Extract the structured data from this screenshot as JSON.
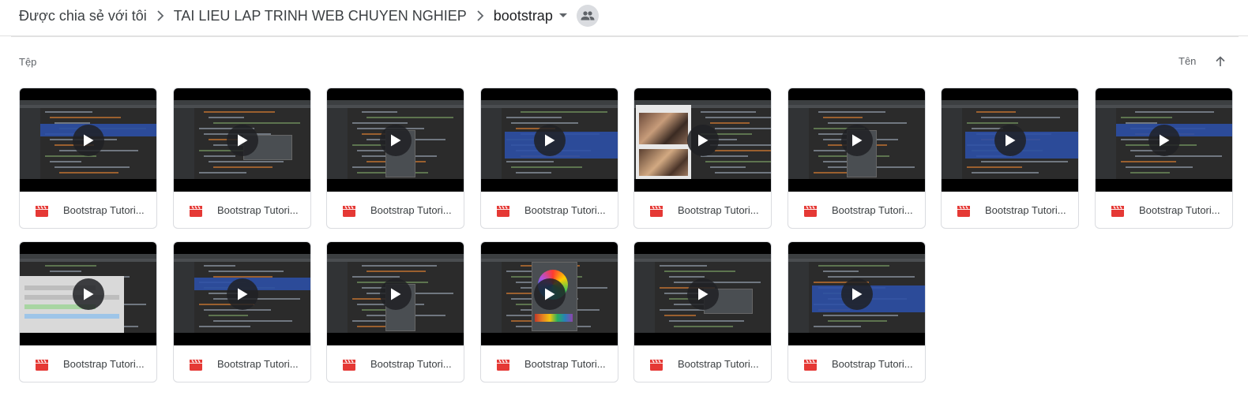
{
  "breadcrumb": {
    "items": [
      "Được chia sẻ với tôi",
      "TAI LIEU LAP TRINH WEB CHUYEN NGHIEP",
      "bootstrap"
    ]
  },
  "files_section": {
    "label": "Tệp",
    "sort_label": "Tên"
  },
  "colors": {
    "video_icon": "#e53935",
    "ide_background": "#2b2b2b",
    "selection": "#2c4fa5"
  },
  "files": [
    {
      "name": "Bootstrap Tutori...",
      "thumb": "editor"
    },
    {
      "name": "Bootstrap Tutori...",
      "thumb": "editor-popup"
    },
    {
      "name": "Bootstrap Tutori...",
      "thumb": "editor-menu"
    },
    {
      "name": "Bootstrap Tutori...",
      "thumb": "editor-highlight"
    },
    {
      "name": "Bootstrap Tutori...",
      "thumb": "browser-photo"
    },
    {
      "name": "Bootstrap Tutori...",
      "thumb": "editor-menu"
    },
    {
      "name": "Bootstrap Tutori...",
      "thumb": "editor-highlight"
    },
    {
      "name": "Bootstrap Tutori...",
      "thumb": "editor"
    },
    {
      "name": "Bootstrap Tutori...",
      "thumb": "browser-page"
    },
    {
      "name": "Bootstrap Tutori...",
      "thumb": "editor-tree"
    },
    {
      "name": "Bootstrap Tutori...",
      "thumb": "editor-menu"
    },
    {
      "name": "Bootstrap Tutori...",
      "thumb": "color-picker"
    },
    {
      "name": "Bootstrap Tutori...",
      "thumb": "editor-popup"
    },
    {
      "name": "Bootstrap Tutori...",
      "thumb": "editor-highlight"
    }
  ]
}
